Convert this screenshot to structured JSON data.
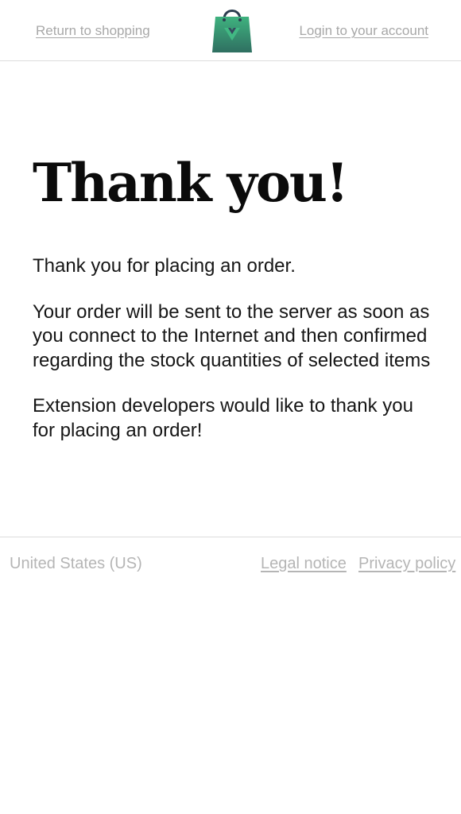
{
  "header": {
    "return_link": "Return to shopping",
    "login_link": "Login to your account",
    "logo_icon": "shopping-bag-icon",
    "logo_colors": {
      "bag_top": "#3fb27f",
      "bag_bottom": "#35495e",
      "handle": "#2c3e50"
    }
  },
  "main": {
    "title": "Thank you!",
    "paragraphs": [
      "Thank you for placing an order.",
      "Your order will be sent to the server as soon as you connect to the Internet and then confirmed regarding the stock quantities of selected items",
      "Extension developers would like to thank you for placing an order!"
    ]
  },
  "footer": {
    "country": "United States (US)",
    "legal_link": "Legal notice",
    "privacy_link": "Privacy policy"
  }
}
